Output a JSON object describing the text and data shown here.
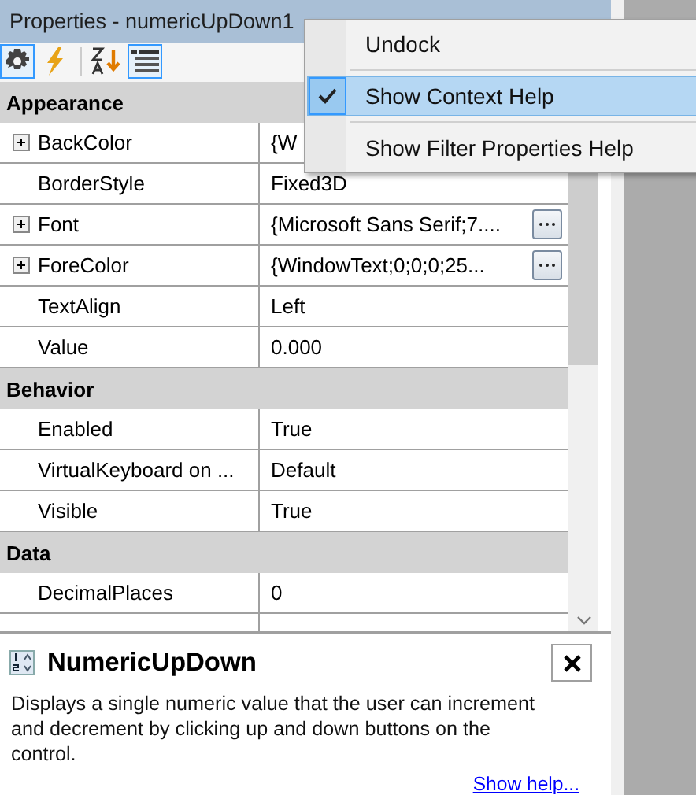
{
  "window": {
    "title": "Properties - numericUpDown1"
  },
  "toolbar": [
    {
      "kind": "properties",
      "selected": true
    },
    {
      "kind": "events",
      "selected": false
    },
    {
      "kind": "alphabetical",
      "selected": false
    },
    {
      "kind": "categorized",
      "selected": true
    }
  ],
  "grid": {
    "rows": [
      {
        "kind": "category",
        "name": "Appearance"
      },
      {
        "kind": "property",
        "name": "BackColor",
        "value": "{W",
        "expandable": true,
        "ellipsis": false
      },
      {
        "kind": "property",
        "name": "BorderStyle",
        "value": "Fixed3D",
        "expandable": false,
        "ellipsis": false
      },
      {
        "kind": "property",
        "name": "Font",
        "value": "{Microsoft Sans Serif;7....",
        "expandable": true,
        "ellipsis": true
      },
      {
        "kind": "property",
        "name": "ForeColor",
        "value": "{WindowText;0;0;0;25...",
        "expandable": true,
        "ellipsis": true
      },
      {
        "kind": "property",
        "name": "TextAlign",
        "value": "Left",
        "expandable": false,
        "ellipsis": false
      },
      {
        "kind": "property",
        "name": "Value",
        "value": "0.000",
        "expandable": false,
        "ellipsis": false
      },
      {
        "kind": "category",
        "name": "Behavior"
      },
      {
        "kind": "property",
        "name": "Enabled",
        "value": "True",
        "expandable": false,
        "ellipsis": false
      },
      {
        "kind": "property",
        "name": "VirtualKeyboard on ...",
        "value": "Default",
        "expandable": false,
        "ellipsis": false
      },
      {
        "kind": "property",
        "name": "Visible",
        "value": "True",
        "expandable": false,
        "ellipsis": false
      },
      {
        "kind": "category",
        "name": "Data"
      },
      {
        "kind": "property",
        "name": "DecimalPlaces",
        "value": "0",
        "expandable": false,
        "ellipsis": false
      }
    ]
  },
  "help": {
    "title": "NumericUpDown",
    "description": "Displays a single numeric value that the user can increment and decrement by clicking up and down buttons on the control.",
    "link": "Show help..."
  },
  "context_menu": {
    "items": [
      {
        "label": "Undock",
        "checked": false,
        "selected": false
      },
      {
        "label": "Show Context Help",
        "checked": true,
        "selected": true
      },
      {
        "label": "Show Filter Properties Help",
        "checked": false,
        "selected": false
      }
    ]
  }
}
